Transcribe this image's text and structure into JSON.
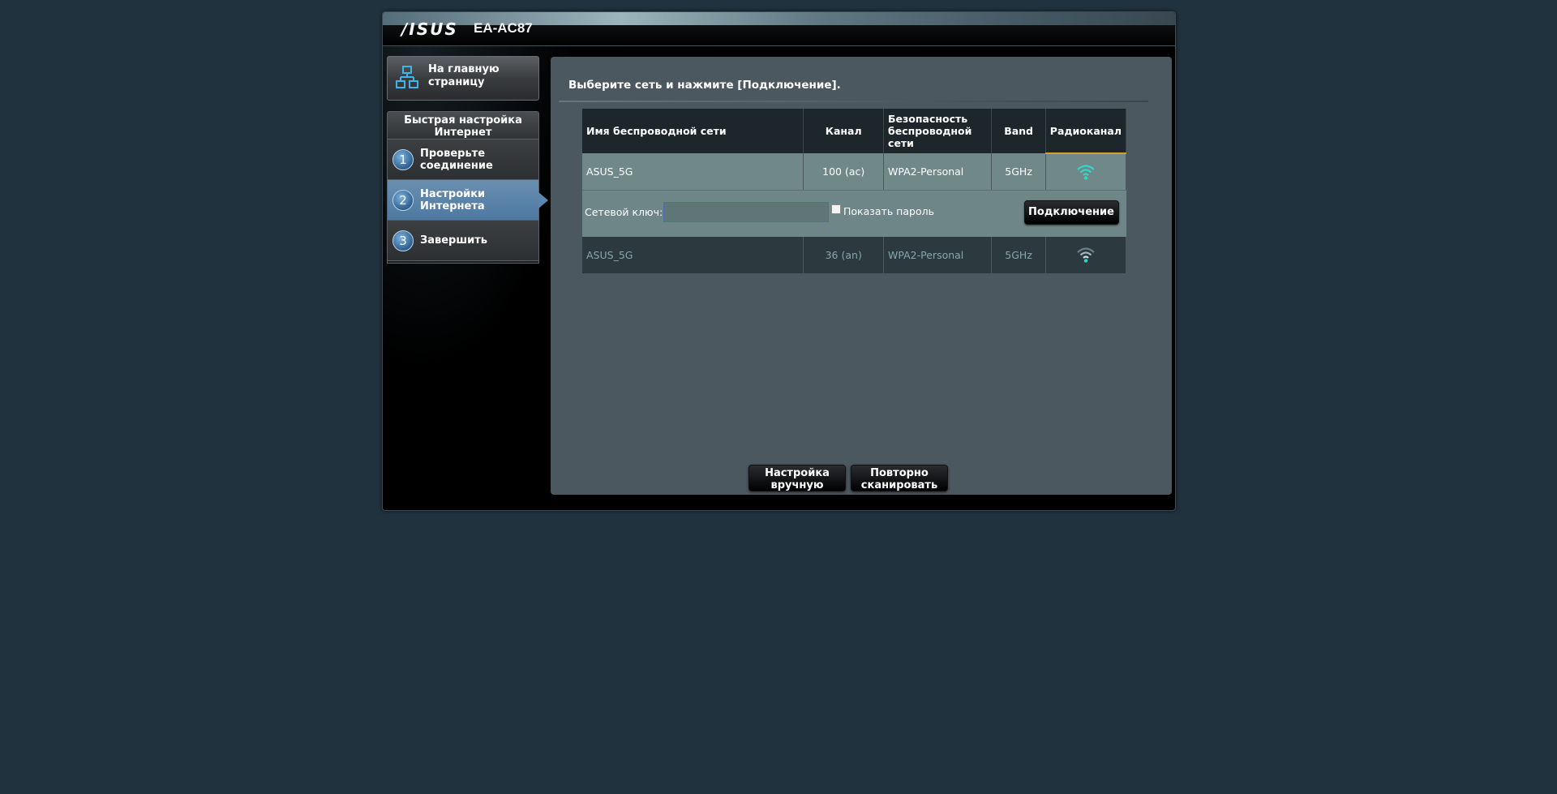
{
  "header": {
    "brand": "/ISUS",
    "model": "EA-AC87"
  },
  "sidebar": {
    "home_label": "На главную страницу",
    "home_icon": "network-icon",
    "quick_setup_title": "Быстрая настройка Интернет",
    "steps": [
      {
        "num": "1",
        "label": "Проверьте соединение"
      },
      {
        "num": "2",
        "label": "Настройки Интернета"
      },
      {
        "num": "3",
        "label": "Завершить"
      }
    ]
  },
  "content": {
    "title": "Выберите сеть и нажмите [Подключение].",
    "columns": [
      "Имя беспроводной сети",
      "Канал",
      "Безопасность беспроводной сети",
      "Band",
      "Радиоканал"
    ],
    "networks": [
      {
        "ssid": "ASUS_5G",
        "channel": "100 (ac)",
        "security": "WPA2-Personal",
        "band": "5GHz",
        "signal_icon": "wifi-signal-icon"
      },
      {
        "ssid": "ASUS_5G",
        "channel": "36 (an)",
        "security": "WPA2-Personal",
        "band": "5GHz",
        "signal_icon": "wifi-signal-icon"
      }
    ],
    "key_label": "Сетевой ключ:",
    "key_value": "",
    "show_password_label": "Показать пароль",
    "connect_label": "Подключение",
    "manual_label": "Настройка вручную",
    "rescan_label": "Повторно сканировать"
  },
  "colors": {
    "background": "#21323f",
    "accent_active": "#5b86ad",
    "signal": "#2fd8c9"
  }
}
